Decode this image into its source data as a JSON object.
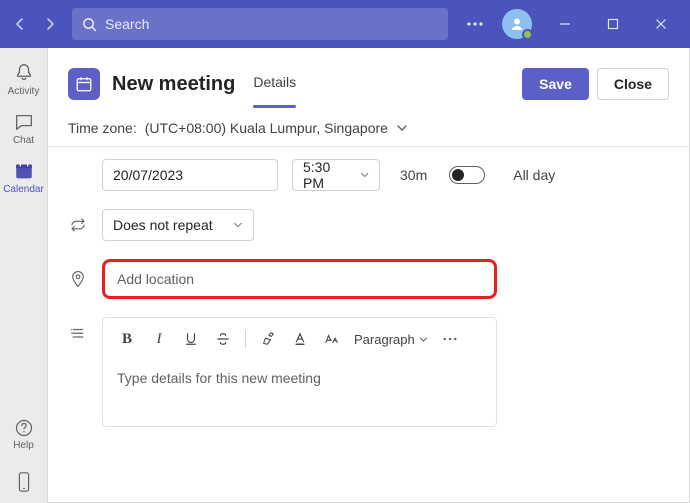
{
  "titlebar": {
    "search_placeholder": "Search"
  },
  "rail": {
    "activity": "Activity",
    "chat": "Chat",
    "calendar": "Calendar",
    "help": "Help"
  },
  "header": {
    "title": "New meeting",
    "tab_details": "Details",
    "save": "Save",
    "close": "Close"
  },
  "timezone": {
    "prefix": "Time zone: ",
    "value": "(UTC+08:00) Kuala Lumpur, Singapore"
  },
  "form": {
    "date": "20/07/2023",
    "time": "5:30 PM",
    "duration": "30m",
    "allday_label": "All day",
    "repeat": "Does not repeat",
    "location_placeholder": "Add location",
    "rte_placeholder": "Type details for this new meeting",
    "paragraph_label": "Paragraph"
  }
}
